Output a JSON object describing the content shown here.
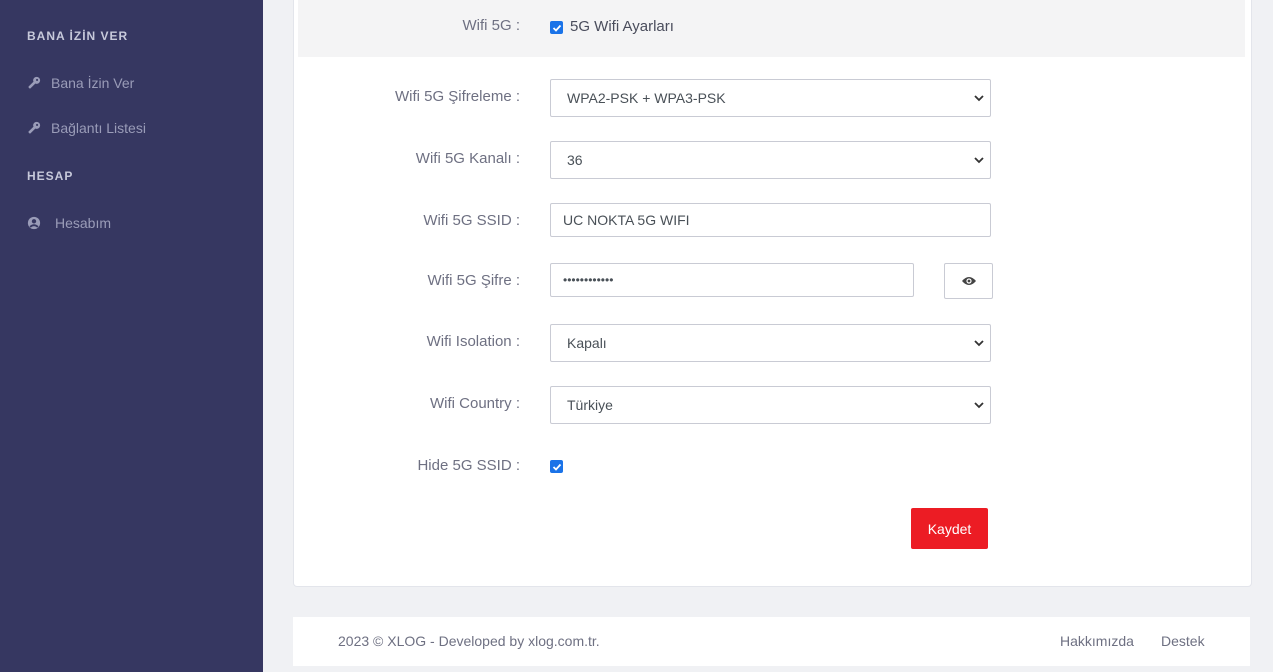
{
  "sidebar": {
    "sections": [
      {
        "title": "BANA İZİN VER",
        "items": [
          {
            "label": "Bana İzin Ver",
            "icon": "key-icon"
          },
          {
            "label": "Bağlantı Listesi",
            "icon": "key-icon"
          }
        ]
      },
      {
        "title": "HESAP",
        "items": [
          {
            "label": "Hesabım",
            "icon": "user-circle-icon"
          }
        ]
      }
    ]
  },
  "form": {
    "wifi5g": {
      "label": "Wifi 5G :",
      "checkbox_label": "5G Wifi Ayarları",
      "checked": true
    },
    "encryption": {
      "label": "Wifi 5G Şifreleme :",
      "value": "WPA2-PSK + WPA3-PSK"
    },
    "channel": {
      "label": "Wifi 5G Kanalı :",
      "value": "36"
    },
    "ssid": {
      "label": "Wifi 5G SSID :",
      "value": "UC NOKTA 5G WIFI"
    },
    "password": {
      "label": "Wifi 5G Şifre :",
      "value": "••••••••••••"
    },
    "isolation": {
      "label": "Wifi Isolation :",
      "value": "Kapalı"
    },
    "country": {
      "label": "Wifi Country :",
      "value": "Türkiye"
    },
    "hide_ssid": {
      "label": "Hide 5G SSID :",
      "checked": true
    },
    "save_label": "Kaydet"
  },
  "footer": {
    "copyright": "2023 © XLOG - Developed by  xlog.com.tr.",
    "links": [
      "Hakkımızda",
      "Destek"
    ]
  },
  "colors": {
    "sidebar": "#363761",
    "accent": "#ec1c24",
    "checkbox": "#1a73e8"
  }
}
